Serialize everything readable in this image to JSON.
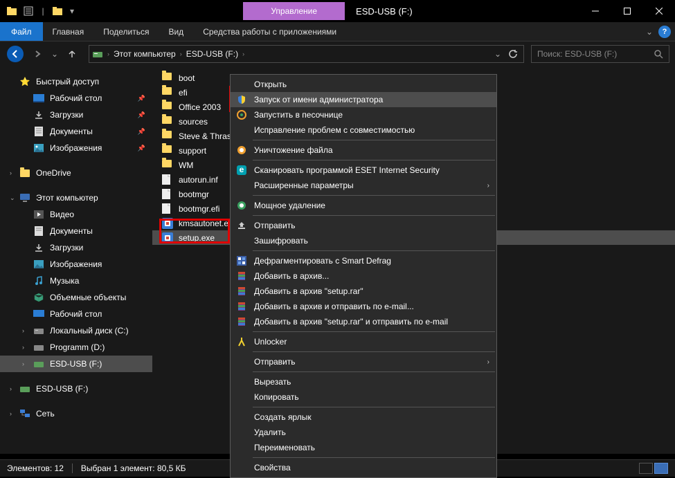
{
  "titlebar": {
    "management_tab": "Управление",
    "title": "ESD-USB (F:)"
  },
  "ribbon": {
    "file": "Файл",
    "tabs": [
      "Главная",
      "Поделиться",
      "Вид",
      "Средства работы с приложениями"
    ]
  },
  "navbar": {
    "crumbs": [
      "Этот компьютер",
      "ESD-USB (F:)"
    ],
    "search_placeholder": "Поиск: ESD-USB (F:)"
  },
  "navpane": {
    "quick_access": "Быстрый доступ",
    "quick_items": [
      {
        "label": "Рабочий стол",
        "pin": true
      },
      {
        "label": "Загрузки",
        "pin": true
      },
      {
        "label": "Документы",
        "pin": true
      },
      {
        "label": "Изображения",
        "pin": true
      }
    ],
    "onedrive": "OneDrive",
    "this_pc": "Этот компьютер",
    "pc_items": [
      "Видео",
      "Документы",
      "Загрузки",
      "Изображения",
      "Музыка",
      "Объемные объекты",
      "Рабочий стол",
      "Локальный диск (C:)",
      "Programm (D:)",
      "ESD-USB (F:)"
    ],
    "esd_usb": "ESD-USB (F:)",
    "network": "Сеть"
  },
  "files": [
    {
      "name": "boot",
      "type": "folder"
    },
    {
      "name": "efi",
      "type": "folder"
    },
    {
      "name": "Office 2003",
      "type": "folder"
    },
    {
      "name": "sources",
      "type": "folder"
    },
    {
      "name": "Steve & Thrash",
      "type": "folder"
    },
    {
      "name": "support",
      "type": "folder"
    },
    {
      "name": "WM",
      "type": "folder"
    },
    {
      "name": "autorun.inf",
      "type": "file"
    },
    {
      "name": "bootmgr",
      "type": "file"
    },
    {
      "name": "bootmgr.efi",
      "type": "file"
    },
    {
      "name": "kmsautonet.exe",
      "type": "exe"
    },
    {
      "name": "setup.exe",
      "type": "exe",
      "selected": true
    }
  ],
  "context_menu": {
    "items": [
      {
        "label": "Открыть",
        "icon": ""
      },
      {
        "label": "Запуск от имени администратора",
        "icon": "shield",
        "highlight": true
      },
      {
        "label": "Запустить в песочнице",
        "icon": "eset-sb"
      },
      {
        "label": "Исправление проблем с совместимостью",
        "icon": ""
      },
      {
        "sep": true
      },
      {
        "label": "Уничтожение файла",
        "icon": "iobit"
      },
      {
        "sep": true
      },
      {
        "label": "Сканировать программой ESET Internet Security",
        "icon": "eset"
      },
      {
        "label": "Расширенные параметры",
        "icon": "",
        "arrow": true
      },
      {
        "sep": true
      },
      {
        "label": "Мощное удаление",
        "icon": "iobit-g"
      },
      {
        "sep": true
      },
      {
        "label": "Отправить",
        "icon": "share"
      },
      {
        "label": "Зашифровать",
        "icon": ""
      },
      {
        "sep": true
      },
      {
        "label": "Дефрагментировать с Smart Defrag",
        "icon": "defrag"
      },
      {
        "label": "Добавить в архив...",
        "icon": "rar"
      },
      {
        "label": "Добавить в архив \"setup.rar\"",
        "icon": "rar"
      },
      {
        "label": "Добавить в архив и отправить по e-mail...",
        "icon": "rar"
      },
      {
        "label": "Добавить в архив \"setup.rar\" и отправить по e-mail",
        "icon": "rar"
      },
      {
        "sep": true
      },
      {
        "label": "Unlocker",
        "icon": "unlocker"
      },
      {
        "sep": true
      },
      {
        "label": "Отправить",
        "icon": "",
        "arrow": true
      },
      {
        "sep": true
      },
      {
        "label": "Вырезать",
        "icon": ""
      },
      {
        "label": "Копировать",
        "icon": ""
      },
      {
        "sep": true
      },
      {
        "label": "Создать ярлык",
        "icon": ""
      },
      {
        "label": "Удалить",
        "icon": ""
      },
      {
        "label": "Переименовать",
        "icon": ""
      },
      {
        "sep": true
      },
      {
        "label": "Свойства",
        "icon": ""
      }
    ]
  },
  "statusbar": {
    "elements": "Элементов: 12",
    "selected": "Выбран 1 элемент: 80,5 КБ"
  }
}
